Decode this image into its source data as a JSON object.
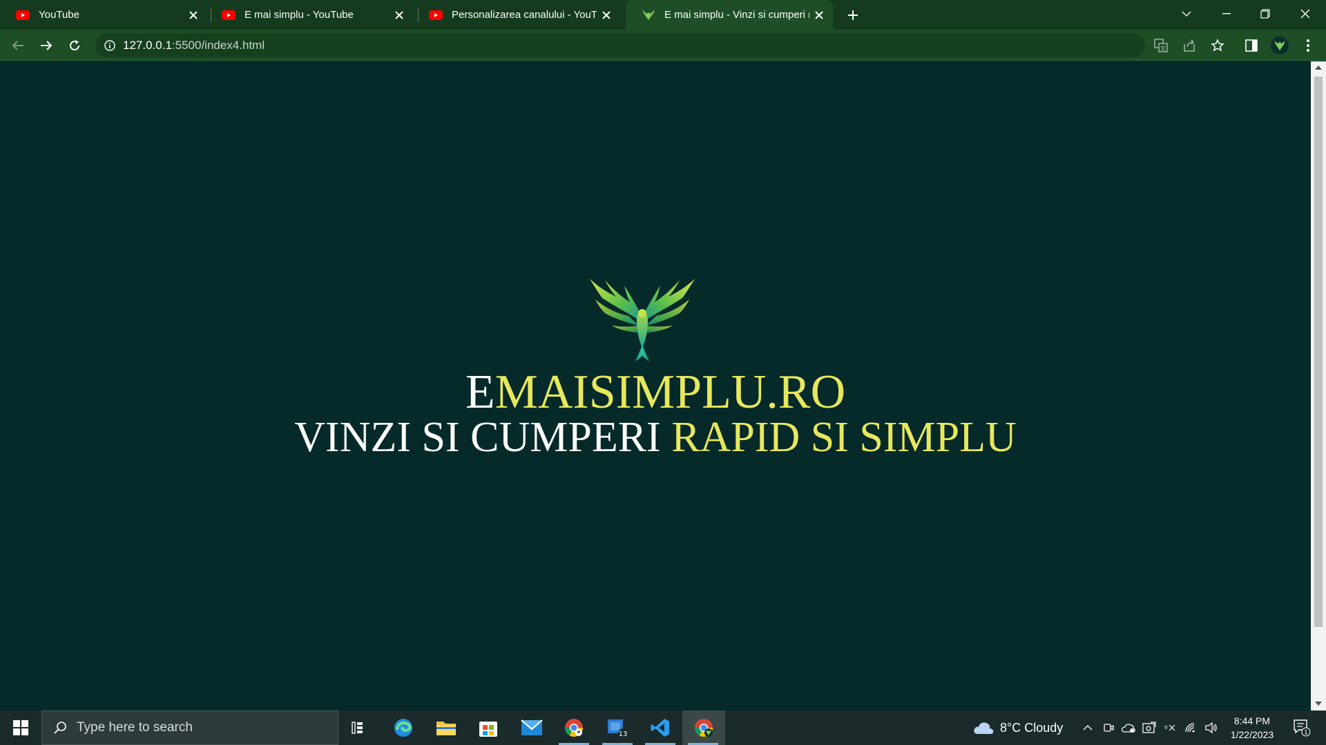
{
  "tabs": [
    {
      "title": "YouTube",
      "icon": "youtube-icon"
    },
    {
      "title": "E mai simplu - YouTube",
      "icon": "youtube-icon"
    },
    {
      "title": "Personalizarea canalului - YouTube",
      "icon": "youtube-icon"
    },
    {
      "title": "E mai simplu - Vinzi si cumperi rapid si simplu",
      "icon": "phoenix-icon",
      "active": true
    }
  ],
  "address_bar": {
    "host": "127.0.0.1",
    "path": ":5500/index4.html"
  },
  "page": {
    "brand_first": "E",
    "brand_rest": "MAISIMPLU.RO",
    "tagline_plain": "VINZI SI CUMPERI ",
    "tagline_highlight": "RAPID SI SIMPLU"
  },
  "taskbar": {
    "search_placeholder": "Type here to search",
    "store_badge": "13",
    "weather": "8°C  Cloudy",
    "time": "8:44 PM",
    "date": "1/22/2023",
    "notification_count": "1"
  },
  "colors": {
    "page_background": "#062a2a",
    "brand_yellow": "#e8e85c",
    "browser_frame": "#163a1e",
    "browser_toolbar": "#1d4e26"
  }
}
